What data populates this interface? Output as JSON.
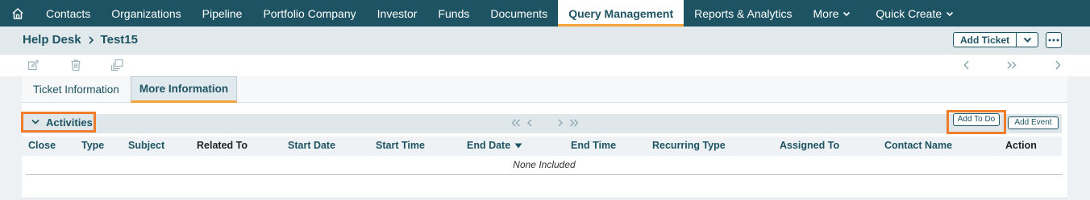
{
  "nav": {
    "items": [
      {
        "label": "Contacts",
        "active": false
      },
      {
        "label": "Organizations",
        "active": false
      },
      {
        "label": "Pipeline",
        "active": false
      },
      {
        "label": "Portfolio Company",
        "active": false
      },
      {
        "label": "Investor",
        "active": false
      },
      {
        "label": "Funds",
        "active": false
      },
      {
        "label": "Documents",
        "active": false
      },
      {
        "label": "Query Management",
        "active": true
      },
      {
        "label": "Reports & Analytics",
        "active": false
      }
    ],
    "more_label": "More",
    "quick_create_label": "Quick Create"
  },
  "breadcrumb": {
    "module": "Help Desk",
    "record": "Test15"
  },
  "header": {
    "add_ticket_label": "Add Ticket"
  },
  "tabs": {
    "ticket_information": "Ticket Information",
    "more_information": "More Information"
  },
  "activities": {
    "title": "Activities",
    "add_todo_label": "Add To Do",
    "add_event_label": "Add Event",
    "columns": {
      "close": "Close",
      "type": "Type",
      "subject": "Subject",
      "related_to": "Related To",
      "start_date": "Start Date",
      "start_time": "Start Time",
      "end_date": "End Date",
      "end_time": "End Time",
      "recurring_type": "Recurring Type",
      "assigned_to": "Assigned To",
      "contact_name": "Contact Name",
      "action": "Action"
    },
    "empty_text": "None Included"
  },
  "colors": {
    "nav_bg": "#1d5362",
    "accent": "#f2a33a",
    "highlight": "#f07d2b",
    "header_bg": "#e2e9ec"
  },
  "icons": {
    "home": "home-icon",
    "edit": "edit-icon",
    "delete": "trash-icon",
    "duplicate": "duplicate-icon",
    "previous": "chevron-left-icon",
    "next": "chevron-right-icon",
    "jump": "double-chevron-right-icon"
  }
}
